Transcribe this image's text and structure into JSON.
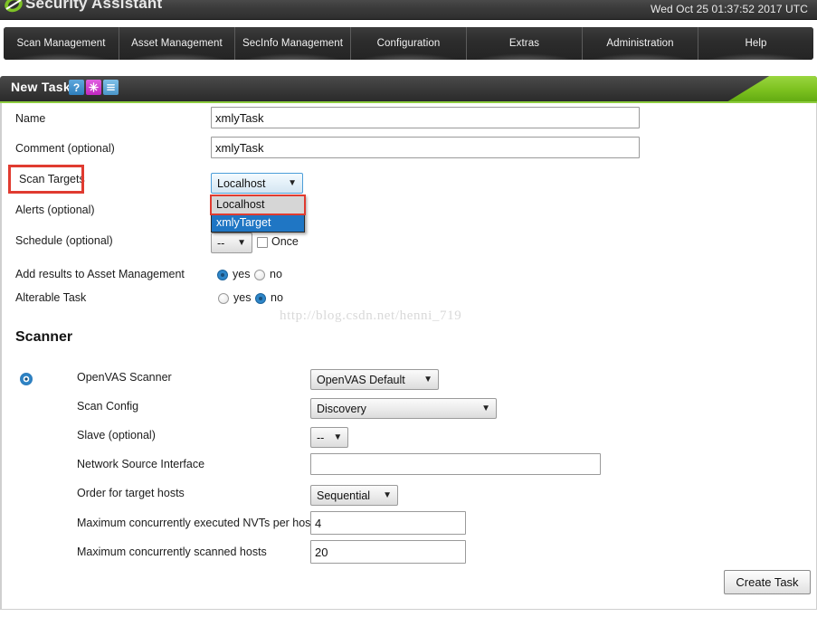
{
  "app": {
    "brand": "Security Assistant",
    "clock": "Wed Oct 25 01:37:52 2017 UTC"
  },
  "nav": {
    "items": [
      {
        "label": "Scan Management"
      },
      {
        "label": "Asset Management"
      },
      {
        "label": "SecInfo Management"
      },
      {
        "label": "Configuration"
      },
      {
        "label": "Extras"
      },
      {
        "label": "Administration"
      },
      {
        "label": "Help"
      }
    ]
  },
  "section": {
    "title": "New Task",
    "icons": [
      {
        "name": "help-icon",
        "glyph": "?"
      },
      {
        "name": "wizard-icon",
        "glyph": "✳"
      },
      {
        "name": "list-icon",
        "glyph": "☰"
      }
    ]
  },
  "form": {
    "name": {
      "label": "Name",
      "value": "xmlyTask"
    },
    "comment": {
      "label": "Comment (optional)",
      "value": "xmlyTask"
    },
    "scan_targets": {
      "label": "Scan Targets",
      "value": "Localhost",
      "options": [
        "Localhost",
        "xmlyTarget"
      ],
      "highlighted_option": "xmlyTarget"
    },
    "alerts": {
      "label": "Alerts (optional)"
    },
    "schedule": {
      "label": "Schedule (optional)",
      "value": "--",
      "once_label": "Once",
      "once_checked": false
    },
    "add_results": {
      "label": "Add results to Asset Management",
      "yes_label": "yes",
      "no_label": "no",
      "selected": "yes"
    },
    "alterable": {
      "label": "Alterable Task",
      "yes_label": "yes",
      "no_label": "no",
      "selected": "no"
    }
  },
  "scanner": {
    "heading": "Scanner",
    "openvas_scanner": {
      "label": "OpenVAS Scanner",
      "value": "OpenVAS Default",
      "selected": true
    },
    "scan_config": {
      "label": "Scan Config",
      "value": "Discovery"
    },
    "slave": {
      "label": "Slave (optional)",
      "value": "--"
    },
    "network_source_interface": {
      "label": "Network Source Interface",
      "value": ""
    },
    "order_target_hosts": {
      "label": "Order for target hosts",
      "value": "Sequential"
    },
    "max_nvts": {
      "label": "Maximum concurrently executed NVTs per host",
      "value": "4"
    },
    "max_hosts": {
      "label": "Maximum concurrently scanned hosts",
      "value": "20"
    }
  },
  "actions": {
    "create_task": "Create Task"
  },
  "watermark": {
    "text": "http://blog.csdn.net/henni_719"
  },
  "colors": {
    "accent_green": "#8dcc3f",
    "annotation_red": "#e03b30",
    "selection_blue": "#1f76c4",
    "topbar_dark": "#3a3a3a"
  }
}
